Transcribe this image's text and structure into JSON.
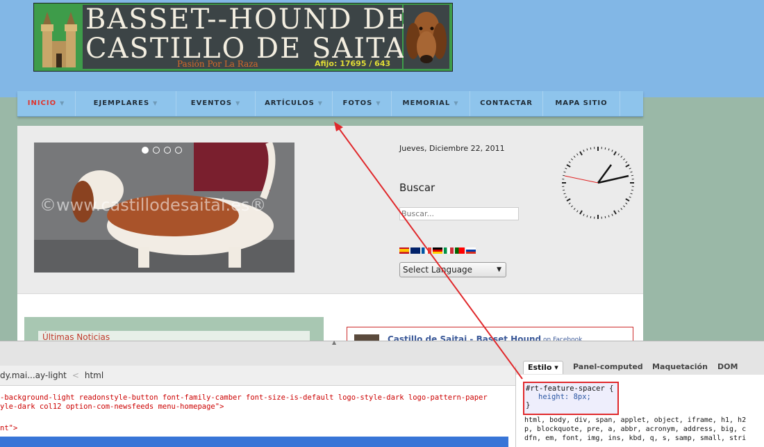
{
  "banner": {
    "title_line1": "BASSET--HOUND DEL",
    "title_line2": "CASTILLO DE SAITAI",
    "motto": "Pasión Por La Raza",
    "afijo": "Afijo: 17695 / 643"
  },
  "nav": {
    "items": [
      {
        "label": "INICIO",
        "active": true,
        "dropdown": true
      },
      {
        "label": "EJEMPLARES",
        "dropdown": true
      },
      {
        "label": "EVENTOS",
        "dropdown": true
      },
      {
        "label": "ARTÍCULOS",
        "dropdown": true
      },
      {
        "label": "FOTOS",
        "dropdown": true
      },
      {
        "label": "MEMORIAL",
        "dropdown": true
      },
      {
        "label": "CONTACTAR",
        "dropdown": false
      },
      {
        "label": "MAPA SITIO",
        "dropdown": false
      }
    ],
    "active_color": "#e0342c"
  },
  "hero": {
    "watermark": "©www.castillodesaitai.es®",
    "slide_count": 4,
    "active_slide": 1
  },
  "sidebar": {
    "date": "Jueves, Diciembre 22, 2011",
    "search_heading": "Buscar",
    "search_placeholder": "Buscar...",
    "language_select": "Select Language"
  },
  "news": {
    "heading": "Últimas Noticias"
  },
  "facebook": {
    "page_name": "Castillo de Saitai - Basset Hound",
    "on_label": "on Facebook"
  },
  "devtools": {
    "breadcrumb_1": "dy.mai...ay-light",
    "breadcrumb_2": "html",
    "code_line1": "-background-light readonstyle-button font-family-camber font-size-is-default logo-style-dark logo-pattern-paper",
    "code_line2": "yle-dark col12 option-com-newsfeeds menu-homepage\">",
    "code_line3": "nt\">",
    "tabs": [
      {
        "label": "Estilo ▾",
        "active": true
      },
      {
        "label": "Panel-computed",
        "active": false
      },
      {
        "label": "Maquetación",
        "active": false
      },
      {
        "label": "DOM",
        "active": false
      }
    ],
    "rule_selector": "#rt-feature-spacer {",
    "rule_prop": "height: 8px;",
    "rule_close": "}",
    "css_line1": "html, body, div, span, applet, object, iframe, h1, h2",
    "css_line2": "p, blockquote, pre, a, abbr, acronym, address, big, c",
    "css_line3": "dfn, em, font, img, ins, kbd, q, s, samp, small, stri"
  },
  "colors": {
    "annotation_red": "#e0282b",
    "selection_blue": "#3875d7"
  }
}
